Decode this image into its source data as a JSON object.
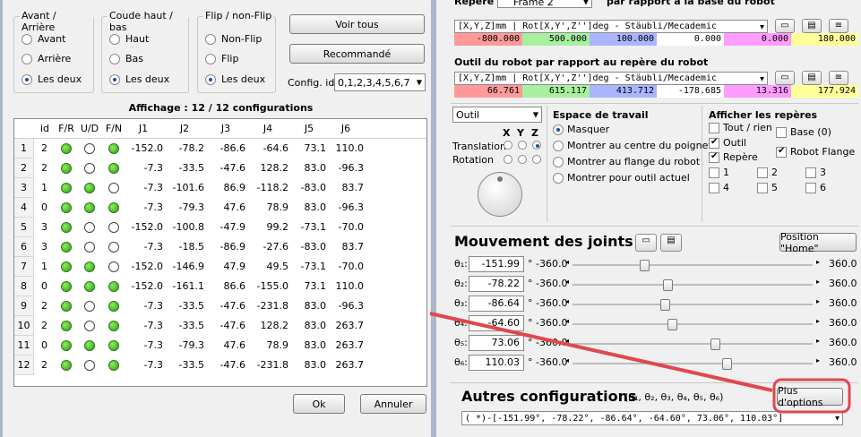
{
  "dialog": {
    "groups": {
      "avant_arriere": {
        "title": "Avant / Arrière",
        "options": [
          "Avant",
          "Arrière",
          "Les deux"
        ],
        "selected": 2
      },
      "coude": {
        "title": "Coude haut / bas",
        "options": [
          "Haut",
          "Bas",
          "Les deux"
        ],
        "selected": 2
      },
      "flip": {
        "title": "Flip / non-Flip",
        "options": [
          "Non-Flip",
          "Flip",
          "Les deux"
        ],
        "selected": 2
      }
    },
    "voir_tous": "Voir tous",
    "recommande": "Recommandé",
    "config_label": "Config. id",
    "config_value": "0,1,2,3,4,5,6,7",
    "affichage": "Affichage : 12 / 12 configurations",
    "columns": [
      "id",
      "F/R",
      "U/D",
      "F/N",
      "J1",
      "J2",
      "J3",
      "J4",
      "J5",
      "J6"
    ],
    "rows": [
      {
        "n": "1",
        "id": "2",
        "fr": "g",
        "ud": "w",
        "fn": "g",
        "j": [
          "-152.0",
          "-78.2",
          "-86.6",
          "-64.6",
          "73.1",
          "110.0"
        ]
      },
      {
        "n": "2",
        "id": "2",
        "fr": "g",
        "ud": "w",
        "fn": "g",
        "j": [
          "-7.3",
          "-33.5",
          "-47.6",
          "128.2",
          "83.0",
          "-96.3"
        ]
      },
      {
        "n": "3",
        "id": "1",
        "fr": "g",
        "ud": "g",
        "fn": "w",
        "j": [
          "-7.3",
          "-101.6",
          "86.9",
          "-118.2",
          "-83.0",
          "83.7"
        ]
      },
      {
        "n": "4",
        "id": "0",
        "fr": "g",
        "ud": "g",
        "fn": "g",
        "j": [
          "-7.3",
          "-79.3",
          "47.6",
          "78.9",
          "83.0",
          "-96.3"
        ]
      },
      {
        "n": "5",
        "id": "3",
        "fr": "g",
        "ud": "w",
        "fn": "w",
        "j": [
          "-152.0",
          "-100.8",
          "-47.9",
          "99.2",
          "-73.1",
          "-70.0"
        ]
      },
      {
        "n": "6",
        "id": "3",
        "fr": "g",
        "ud": "w",
        "fn": "w",
        "j": [
          "-7.3",
          "-18.5",
          "-86.9",
          "-27.6",
          "-83.0",
          "83.7"
        ]
      },
      {
        "n": "7",
        "id": "1",
        "fr": "g",
        "ud": "g",
        "fn": "w",
        "j": [
          "-152.0",
          "-146.9",
          "47.9",
          "49.5",
          "-73.1",
          "-70.0"
        ]
      },
      {
        "n": "8",
        "id": "0",
        "fr": "g",
        "ud": "g",
        "fn": "g",
        "j": [
          "-152.0",
          "-161.1",
          "86.6",
          "-155.0",
          "73.1",
          "110.0"
        ]
      },
      {
        "n": "9",
        "id": "2",
        "fr": "g",
        "ud": "w",
        "fn": "g",
        "j": [
          "-7.3",
          "-33.5",
          "-47.6",
          "-231.8",
          "83.0",
          "-96.3"
        ]
      },
      {
        "n": "10",
        "id": "2",
        "fr": "g",
        "ud": "w",
        "fn": "g",
        "j": [
          "-7.3",
          "-33.5",
          "-47.6",
          "128.2",
          "83.0",
          "263.7"
        ]
      },
      {
        "n": "11",
        "id": "0",
        "fr": "g",
        "ud": "g",
        "fn": "g",
        "j": [
          "-7.3",
          "-79.3",
          "47.6",
          "78.9",
          "83.0",
          "263.7"
        ]
      },
      {
        "n": "12",
        "id": "2",
        "fr": "g",
        "ud": "w",
        "fn": "g",
        "j": [
          "-7.3",
          "-33.5",
          "-47.6",
          "-231.8",
          "83.0",
          "263.7"
        ]
      }
    ],
    "ok": "Ok",
    "annuler": "Annuler"
  },
  "right": {
    "repere_label": "Repère",
    "frame_value": "Frame 2",
    "repere_suffix": "par rapport à la base du robot",
    "repere_format": "[X,Y,Z]mm | Rot[X,Y',Z'']deg - Stäubli/Mecademic",
    "repere_values": [
      "-800.000",
      "500.000",
      "100.000",
      "0.000",
      "0.000",
      "180.000"
    ],
    "outil_title": "Outil du robot par rapport au repère du robot",
    "outil_format": "[X,Y,Z]mm | Rot[X,Y',Z'']deg - Stäubli/Mecademic",
    "outil_values": [
      "66.761",
      "615.117",
      "413.712",
      "-178.685",
      "13.316",
      "177.924"
    ],
    "value_colors": [
      "#ff9999",
      "#a8f0a0",
      "#aab4ff",
      "#ffffff",
      "#ff9cff",
      "#ffff99"
    ],
    "outil_combo": "Outil",
    "xyz": [
      "X",
      "Y",
      "Z"
    ],
    "translation": "Translation",
    "rotation": "Rotation",
    "espace": {
      "title": "Espace de travail",
      "options": [
        "Masquer",
        "Montrer au centre du poignet",
        "Montrer au flange du robot",
        "Montrer pour outil actuel"
      ],
      "selected": 0
    },
    "afficher": {
      "title": "Afficher les repères",
      "tout_rien": "Tout / rien",
      "base": "Base (0)",
      "outil": "Outil",
      "repere": "Repère",
      "robot_flange": "Robot Flange",
      "nums": [
        "1",
        "2",
        "3",
        "4",
        "5",
        "6"
      ]
    },
    "mouvement_title": "Mouvement des joints",
    "position_home": "Position \"Home\"",
    "joints": [
      {
        "label": "θ₁:",
        "value": "-151.99",
        "min": "-360.0",
        "max": "360.0",
        "pos": -151.99
      },
      {
        "label": "θ₂:",
        "value": "-78.22",
        "min": "-360.0",
        "max": "360.0",
        "pos": -78.22
      },
      {
        "label": "θ₃:",
        "value": "-86.64",
        "min": "-360.0",
        "max": "360.0",
        "pos": -86.64
      },
      {
        "label": "θ₄:",
        "value": "-64.60",
        "min": "-360.0",
        "max": "360.0",
        "pos": -64.6
      },
      {
        "label": "θ₅:",
        "value": "73.06",
        "min": "-360.0",
        "max": "360.0",
        "pos": 73.06
      },
      {
        "label": "θ₆:",
        "value": "110.03",
        "min": "-360.0",
        "max": "360.0",
        "pos": 110.03
      }
    ],
    "autres_title": "Autres configurations",
    "autres_sub": "(θ₁, θ₂, θ₃, θ₄, θ₅, θ₆)",
    "plus_options": "Plus d'options",
    "config_combo": "( *)-[-151.99°,  -78.22°,  -86.64°,  -64.60°,  73.06°,  110.03°]"
  }
}
